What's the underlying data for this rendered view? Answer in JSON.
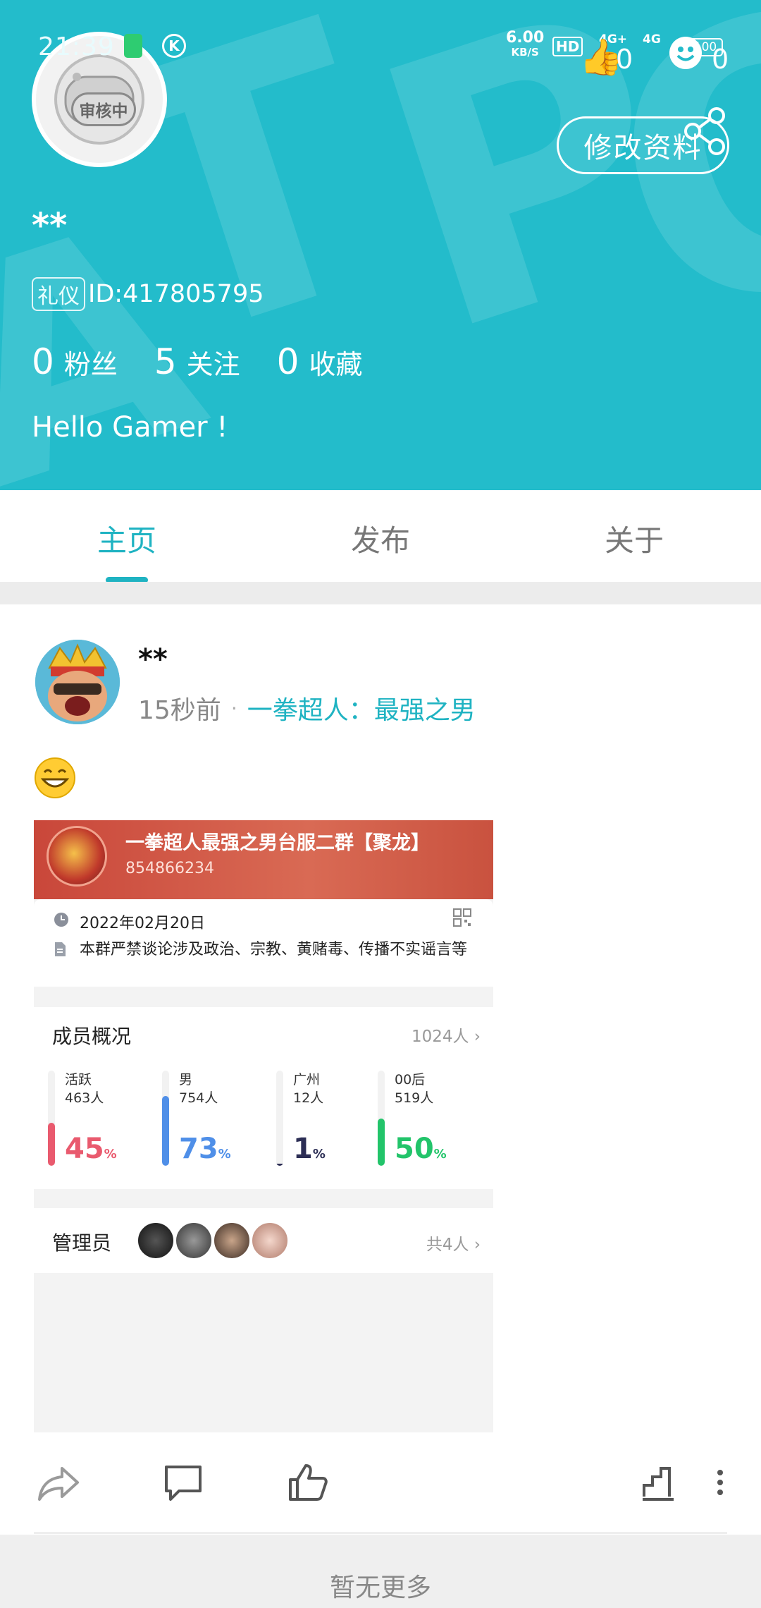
{
  "status_bar": {
    "time": "21:39",
    "net_speed": "6.00",
    "net_unit": "KB/S",
    "hd": "HD",
    "sig1": "4G+",
    "sig2": "4G",
    "battery": "100"
  },
  "profile": {
    "avatar_badge": "审核中",
    "edit_button": "修改资料",
    "username": "**",
    "id_tag": "礼仪",
    "id_text": "ID:417805795",
    "stats": [
      {
        "num": "0",
        "label": "粉丝"
      },
      {
        "num": "5",
        "label": "关注"
      },
      {
        "num": "0",
        "label": "收藏"
      }
    ],
    "bio": "Hello Gamer !",
    "overlay_counts": {
      "likes": "0",
      "emoji": "0"
    }
  },
  "tabs": [
    {
      "label": "主页",
      "active": true
    },
    {
      "label": "发布",
      "active": false
    },
    {
      "label": "关于",
      "active": false
    }
  ],
  "post": {
    "user": "**",
    "time": "15秒前",
    "dot": "·",
    "game": "一拳超人：最强之男",
    "card": {
      "group_name": "一拳超人最强之男台服二群【聚龙】",
      "group_number": "854866234",
      "date": "2022年02月20日",
      "rule": "本群严禁谈论涉及政治、宗教、黄赌毒、传播不实谣言等",
      "members_title": "成员概况",
      "members_count": "1024人",
      "stats": [
        {
          "label": "活跃",
          "count": "463人",
          "pct": 45,
          "pct_text": "45",
          "unit": "%",
          "color": "#e95a6e"
        },
        {
          "label": "男",
          "count": "754人",
          "pct": 73,
          "pct_text": "73",
          "unit": "%",
          "color": "#4f8fe8"
        },
        {
          "label": "广州",
          "count": "12人",
          "pct": 1,
          "pct_text": "1",
          "unit": "%",
          "color": "#2c2e55"
        },
        {
          "label": "00后",
          "count": "519人",
          "pct": 50,
          "pct_text": "50",
          "unit": "%",
          "color": "#22c46a"
        }
      ],
      "admins_title": "管理员",
      "admins_count": "共4人"
    }
  },
  "footer": {
    "text": "暂无更多"
  },
  "colors": {
    "accent": "#23bccb",
    "tab_active": "#1fb3c2"
  }
}
